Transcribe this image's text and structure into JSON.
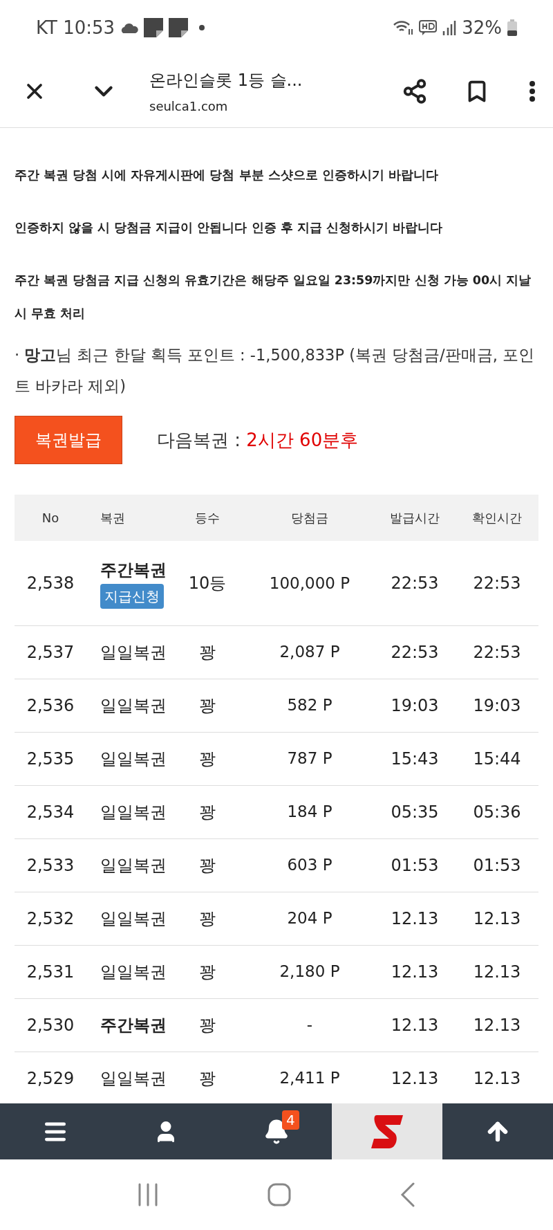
{
  "status_bar": {
    "carrier_time": "KT 10:53",
    "battery": "32%"
  },
  "browser_header": {
    "title": "온라인슬롯 1등 슬...",
    "url": "seulca1.com"
  },
  "notices": [
    "주간 복권 당첨 시에 자유게시판에 당첨 부분 스샷으로 인증하시기 바랍니다",
    "인증하지 않을 시 당첨금 지급이 안됩니다 인증 후 지급 신청하시기 바랍니다",
    "주간 복권 당첨금 지급 신청의 유효기간은 해당주 일요일 23:59까지만 신청 가능 00시 지날 시 무효 처리"
  ],
  "points_line": "· **망고**님 최근 한달 획득 포인트 : -1,500,833P (복권 당첨금/판매금, 포인트 바카라 제외)",
  "issue_button": "복권발급",
  "next_label": "다음복권 : ",
  "next_time": "2시간 60분후",
  "table": {
    "columns": [
      "No",
      "복권",
      "등수",
      "당첨금",
      "발급시간",
      "확인시간"
    ],
    "rows": [
      {
        "no": "2,538",
        "lottery": "주간복권",
        "kind": "weekly",
        "action": "지급신청",
        "rank": "10등",
        "prize": "100,000 P",
        "issued": "22:53",
        "checked": "22:53"
      },
      {
        "no": "2,537",
        "lottery": "일일복권",
        "kind": "daily",
        "rank": "꽝",
        "prize": "2,087 P",
        "issued": "22:53",
        "checked": "22:53"
      },
      {
        "no": "2,536",
        "lottery": "일일복권",
        "kind": "daily",
        "rank": "꽝",
        "prize": "582 P",
        "issued": "19:03",
        "checked": "19:03"
      },
      {
        "no": "2,535",
        "lottery": "일일복권",
        "kind": "daily",
        "rank": "꽝",
        "prize": "787 P",
        "issued": "15:43",
        "checked": "15:44"
      },
      {
        "no": "2,534",
        "lottery": "일일복권",
        "kind": "daily",
        "rank": "꽝",
        "prize": "184 P",
        "issued": "05:35",
        "checked": "05:36"
      },
      {
        "no": "2,533",
        "lottery": "일일복권",
        "kind": "daily",
        "rank": "꽝",
        "prize": "603 P",
        "issued": "01:53",
        "checked": "01:53"
      },
      {
        "no": "2,532",
        "lottery": "일일복권",
        "kind": "daily",
        "rank": "꽝",
        "prize": "204 P",
        "issued": "12.13",
        "checked": "12.13"
      },
      {
        "no": "2,531",
        "lottery": "일일복권",
        "kind": "daily",
        "rank": "꽝",
        "prize": "2,180 P",
        "issued": "12.13",
        "checked": "12.13"
      },
      {
        "no": "2,530",
        "lottery": "주간복권",
        "kind": "weekly",
        "rank": "꽝",
        "prize": "-",
        "issued": "12.13",
        "checked": "12.13"
      },
      {
        "no": "2,529",
        "lottery": "일일복권",
        "kind": "daily",
        "rank": "꽝",
        "prize": "2,411 P",
        "issued": "12.13",
        "checked": "12.13"
      }
    ]
  },
  "bottom_nav": [
    {
      "kind": "menu"
    },
    {
      "kind": "user"
    },
    {
      "kind": "bell",
      "badge": "4"
    },
    {
      "kind": "logo"
    },
    {
      "kind": "top"
    }
  ]
}
